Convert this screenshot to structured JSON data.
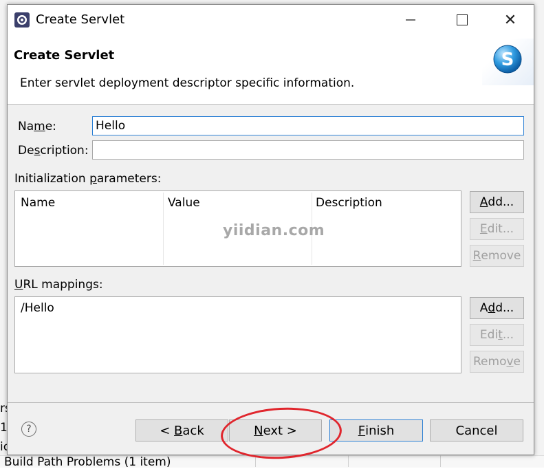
{
  "background": {
    "left_fragments": [
      "rs",
      "1",
      "ic"
    ],
    "bottom_text": "Build Path Problems (1 item)"
  },
  "window": {
    "title": "Create Servlet",
    "minimize_icon": "minimize-icon",
    "maximize_icon": "maximize-icon",
    "close_glyph": "✕"
  },
  "banner": {
    "title": "Create Servlet",
    "description": "Enter servlet deployment descriptor specific information.",
    "icon_letter": "S"
  },
  "form": {
    "name_label_pre": "Na",
    "name_label_u": "m",
    "name_label_post": "e:",
    "name_value": "Hello",
    "description_label_pre": "De",
    "description_label_u": "s",
    "description_label_post": "cription:",
    "description_value": ""
  },
  "init_params": {
    "label_pre": "Initialization ",
    "label_u": "p",
    "label_post": "arameters:",
    "columns": [
      "Name",
      "Value",
      "Description"
    ],
    "rows": [],
    "buttons": {
      "add_u": "A",
      "add_rest": "dd...",
      "edit_u": "E",
      "edit_rest": "dit...",
      "remove_u": "R",
      "remove_rest": "emove"
    }
  },
  "url_mappings": {
    "label_pre": "",
    "label_u": "U",
    "label_post": "RL mappings:",
    "items": [
      "/Hello"
    ],
    "buttons": {
      "add_pre": "A",
      "add_u": "d",
      "add_rest": "d...",
      "edit_pre": "Edi",
      "edit_u": "t",
      "edit_rest": "...",
      "remove_pre": "Remo",
      "remove_u": "v",
      "remove_rest": "e"
    }
  },
  "watermark": "yiidian.com",
  "footer": {
    "help_glyph": "?",
    "back_pre": "< ",
    "back_u": "B",
    "back_rest": "ack",
    "next_u": "N",
    "next_rest": "ext >",
    "finish_u": "F",
    "finish_rest": "inish",
    "cancel": "Cancel"
  },
  "colors": {
    "accent_focus": "#2a7fd4",
    "annotation": "#e0262d",
    "dialog_bg": "#f0f0f0"
  }
}
